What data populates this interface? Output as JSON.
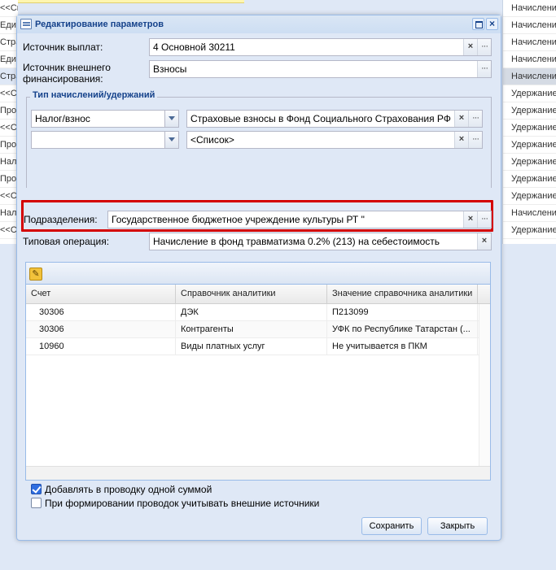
{
  "background": {
    "left_rows": [
      "<<Список>>",
      "Един",
      "Стра",
      "Един",
      "Стра",
      "<<С",
      "Про",
      "<<С",
      "Про",
      "Нал",
      "Про",
      "<<С",
      "Нал",
      "<<С"
    ],
    "right_rows": [
      "Начисление",
      "Начисление",
      "Начисление",
      "Начисление",
      "Начисление",
      "Удержание",
      "Удержание",
      "Удержание",
      "Удержание",
      "Удержание",
      "Удержание",
      "Удержание",
      "Начисление",
      "Удержание"
    ]
  },
  "window": {
    "title": "Редактирование параметров",
    "close_glyph": "×"
  },
  "form": {
    "payment_source": {
      "label": "Источник выплат:",
      "value": "4 Основной 30211"
    },
    "external_financing": {
      "label": "Источник внешнего финансирования:",
      "value": "Взносы"
    },
    "accrual_type_legend": "Тип начислений/удержаний",
    "tax_select_value": "Налог/взнос",
    "tax_value": "Страховые взносы в Фонд Социального Страхования РФ в",
    "second_select_value": "",
    "list_value": "<Список>",
    "subdivisions": {
      "label": "Подразделения:",
      "value": "Государственное бюджетное учреждение культуры РТ \""
    },
    "typical_operation": {
      "label": "Типовая операция:",
      "value": "Начисление в фонд травматизма 0.2% (213) на себестоимость"
    },
    "clear_glyph": "×",
    "dots_glyph": "···"
  },
  "grid": {
    "edit_glyph": "✎",
    "columns": [
      "Счет",
      "Справочник аналитики",
      "Значение справочника аналитики"
    ],
    "rows": [
      [
        "30306",
        "ДЭК",
        "П213099"
      ],
      [
        "30306",
        "Контрагенты",
        "УФК по Республике Татарстан (..."
      ],
      [
        "10960",
        "Виды платных услуг",
        "Не учитывается в ПКМ"
      ]
    ]
  },
  "options": {
    "single_sum": {
      "label": "Добавлять в проводку одной суммой",
      "checked": true
    },
    "external_sources": {
      "label": "При формировании проводок учитывать внешние источники",
      "checked": false
    }
  },
  "buttons": {
    "save": "Сохранить",
    "close": "Закрыть"
  }
}
